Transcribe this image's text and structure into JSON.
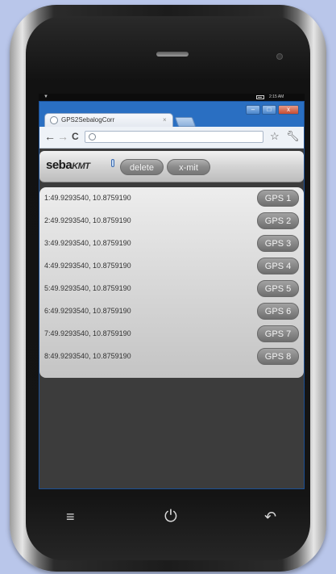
{
  "status_bar": {
    "time": "2:15 AM"
  },
  "browser": {
    "tab_title": "GPS2SebalogCorr",
    "tab_close": "×",
    "window_buttons": [
      "–",
      "□",
      "x"
    ],
    "nav": {
      "back": "←",
      "forward": "→",
      "reload": "C"
    }
  },
  "app": {
    "logo_main": "seba",
    "logo_sub": "KMT",
    "delete_label": "delete",
    "xmit_label": "x-mit",
    "rows": [
      {
        "text": "1:49.9293540, 10.8759190",
        "button": "GPS 1"
      },
      {
        "text": "2:49.9293540, 10.8759190",
        "button": "GPS 2"
      },
      {
        "text": "3:49.9293540, 10.8759190",
        "button": "GPS 3"
      },
      {
        "text": "4:49.9293540, 10.8759190",
        "button": "GPS 4"
      },
      {
        "text": "5:49.9293540, 10.8759190",
        "button": "GPS 5"
      },
      {
        "text": "6:49.9293540, 10.8759190",
        "button": "GPS 6"
      },
      {
        "text": "7:49.9293540, 10.8759190",
        "button": "GPS 7"
      },
      {
        "text": "8:49.9293540, 10.8759190",
        "button": "GPS 8"
      }
    ]
  },
  "phone": {
    "menu_icon": "≡",
    "power_icon": "⏻",
    "back_icon": "↶"
  },
  "colors": {
    "background": "#b9c6ea",
    "window_frame": "#2a6fc2",
    "page_background": "#3c3c3c"
  }
}
